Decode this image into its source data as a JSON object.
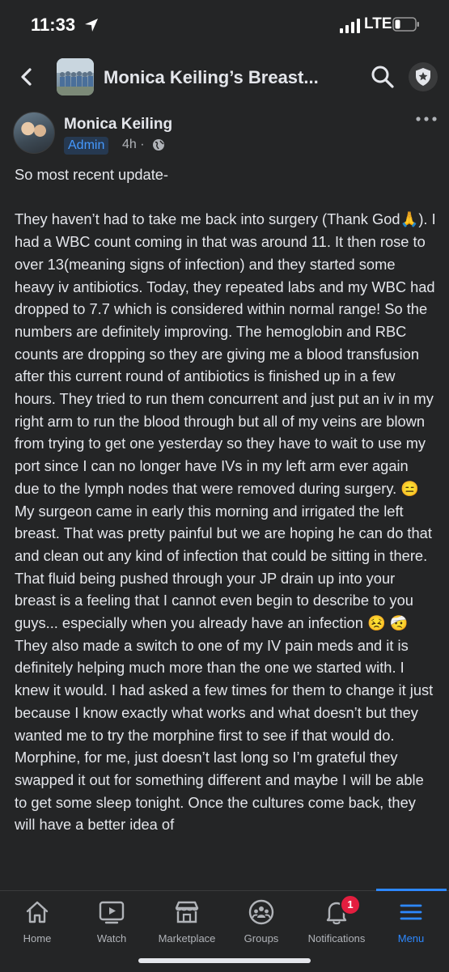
{
  "status_bar": {
    "time": "11:33",
    "network": "LTE"
  },
  "nav": {
    "title": "Monica Keiling’s Breast..."
  },
  "post": {
    "author": "Monica Keiling",
    "badge": "Admin",
    "time": "4h ·",
    "paragraph1": "So most recent update-",
    "paragraph2": "They haven’t had to take me back into surgery (Thank God🙏). I had a WBC count coming in that was around 11. It then rose to over 13(meaning signs of infection) and they started some heavy iv antibiotics. Today, they repeated labs and my WBC had dropped to 7.7 which is considered within normal range! So the numbers are definitely improving. The hemoglobin and RBC counts are dropping so they are giving me a blood transfusion after this current round of antibiotics is finished up in a few hours. They tried to run them concurrent and just put an iv in my right arm to run the blood through but all of my veins are blown from trying to get one yesterday so they have to wait to use my port since I can no longer have IVs in my left arm ever again due to the lymph nodes that were removed during surgery. 😑 My surgeon came in early this morning and irrigated the left breast. That was pretty painful but we are hoping he can do that and clean out any kind of infection that could be sitting in there. That fluid being pushed through your JP drain up into your breast is a feeling that I cannot even begin to describe to you guys... especially when you already have an infection 😣 🤕 They also made a switch to one of my IV pain meds and it is definitely helping much more than the one we started with. I knew it would. I had asked a few times for them to change it just because I know exactly what works and what doesn’t but they wanted me to try the morphine first to see if that would do. Morphine, for me, just doesn’t last long so I’m grateful they swapped it out for something different and maybe I will be able to get some sleep tonight. Once the cultures come back, they will have a better idea of"
  },
  "tabs": [
    {
      "label": "Home",
      "icon": "home-icon"
    },
    {
      "label": "Watch",
      "icon": "watch-icon"
    },
    {
      "label": "Marketplace",
      "icon": "marketplace-icon"
    },
    {
      "label": "Groups",
      "icon": "groups-icon"
    },
    {
      "label": "Notifications",
      "icon": "bell-icon",
      "badge": "1"
    },
    {
      "label": "Menu",
      "icon": "menu-icon",
      "active": true
    }
  ],
  "colors": {
    "background": "#242526",
    "text": "#e4e6eb",
    "secondary_text": "#b0b3b8",
    "accent": "#2d88ff",
    "badge_red": "#e41e3f"
  }
}
